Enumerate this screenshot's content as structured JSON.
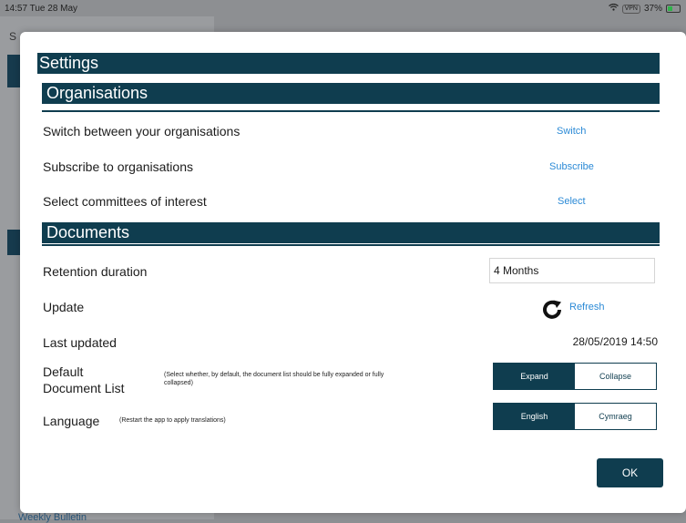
{
  "status_bar": {
    "time": "14:57  Tue 28 May",
    "battery": "37%",
    "battery_pill": "VPN"
  },
  "background": {
    "letter": "S",
    "bottom_text": "Weekly Bulletin"
  },
  "settings": {
    "title": "Settings",
    "organisations": {
      "heading": "Organisations",
      "rows": [
        {
          "label": "Switch between your organisations",
          "action": "Switch"
        },
        {
          "label": "Subscribe to organisations",
          "action": "Subscribe"
        },
        {
          "label": "Select committees of interest",
          "action": "Select"
        }
      ]
    },
    "documents": {
      "heading": "Documents",
      "retention_label": "Retention duration",
      "retention_value": "4 Months",
      "update_label": "Update",
      "refresh_label": "Refresh",
      "last_updated_label": "Last updated",
      "last_updated_value": "28/05/2019 14:50",
      "default_list_label_line1": "Default",
      "default_list_label_line2": "Document List",
      "default_list_hint": "(Select whether, by default, the document list should be fully expanded or fully collapsed)",
      "expand": "Expand",
      "collapse": "Collapse",
      "language_label": "Language",
      "language_hint": "(Restart the app to apply translations)",
      "english": "English",
      "cymraeg": "Cymraeg"
    },
    "ok": "OK"
  },
  "colors": {
    "bar": "#0f3d4f",
    "link": "#2b8ad6"
  },
  "icons": {
    "refresh": "refresh-icon"
  }
}
